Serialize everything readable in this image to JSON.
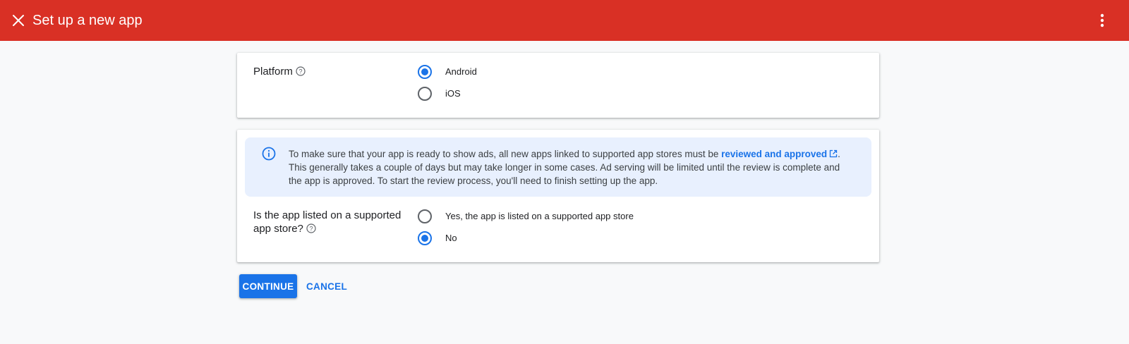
{
  "header": {
    "title": "Set up a new app",
    "close_icon": "close-icon",
    "more_icon": "more-vert-icon",
    "background_color": "#d93025"
  },
  "platform": {
    "label": "Platform",
    "help_icon": "help-icon",
    "options": [
      {
        "label": "Android",
        "checked": true
      },
      {
        "label": "iOS",
        "checked": false
      }
    ]
  },
  "notice": {
    "icon": "info-icon",
    "text_before": "To make sure that your app is ready to show ads, all new apps linked to supported app stores must be ",
    "link_text": "reviewed and approved",
    "link_icon": "open-in-new-icon",
    "text_after": ". This generally takes a couple of days but may take longer in some cases. Ad serving will be limited until the review is complete and the app is approved. To start the review process, you'll need to finish setting up the app."
  },
  "listing": {
    "label_line1": "Is the app listed on a supported",
    "label_line2": "app store?",
    "help_icon": "help-icon",
    "options": [
      {
        "label": "Yes, the app is listed on a supported app store",
        "checked": false
      },
      {
        "label": "No",
        "checked": true
      }
    ]
  },
  "actions": {
    "continue_label": "CONTINUE",
    "cancel_label": "CANCEL",
    "accent_color": "#1a73e8"
  }
}
